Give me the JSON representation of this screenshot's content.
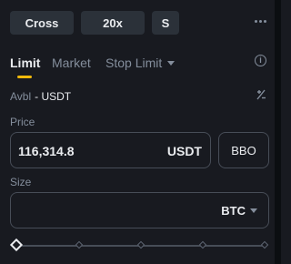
{
  "header": {
    "margin_mode": "Cross",
    "leverage": "20x",
    "position_mode": "S",
    "more_icon": "ellipsis-horizontal-icon"
  },
  "order_tabs": {
    "items": [
      {
        "label": "Limit",
        "active": true
      },
      {
        "label": "Market",
        "active": false
      },
      {
        "label": "Stop Limit",
        "active": false,
        "has_dropdown": true
      }
    ],
    "info_icon": "info-circle-icon"
  },
  "balance": {
    "label": "Avbl",
    "value": "- USDT",
    "transfer_icon": "transfer-icon"
  },
  "price": {
    "label": "Price",
    "value": "116,314.8",
    "unit": "USDT",
    "bbo_label": "BBO"
  },
  "size": {
    "label": "Size",
    "value": "",
    "unit": "BTC"
  },
  "slider": {
    "percent": 0,
    "marks": [
      0,
      25,
      50,
      75,
      100
    ]
  },
  "colors": {
    "background": "#181a20",
    "accent": "#f0b90b",
    "text_primary": "#eaecef",
    "text_secondary": "#848e9c",
    "border": "#474d57",
    "pill_bg": "#2b3139"
  }
}
